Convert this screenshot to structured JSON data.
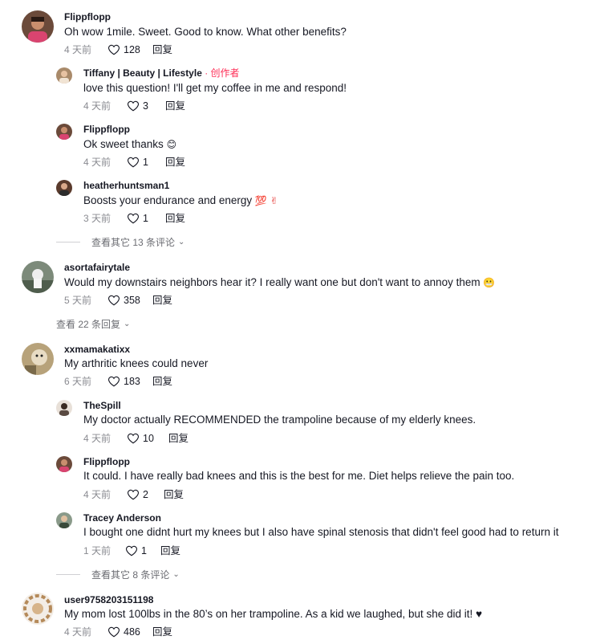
{
  "comments": [
    {
      "user": "Flippflopp",
      "text": "Oh wow 1mile. Sweet. Good to know. What other benefits?",
      "time": "4 天前",
      "likes": "128",
      "reply": "回复"
    },
    {
      "user": "Tiffany | Beauty | Lifestyle",
      "creator": " · 创作者",
      "text": "love this question! I'll get my coffee in me and respond!",
      "time": "4 天前",
      "likes": "3",
      "reply": "回复"
    },
    {
      "user": "Flippflopp",
      "text": "Ok sweet thanks",
      "emoji": "😊",
      "time": "4 天前",
      "likes": "1",
      "reply": "回复"
    },
    {
      "user": "heatherhuntsman1",
      "text": "Boosts your endurance and energy",
      "emoji": "💯 ✌",
      "time": "3 天前",
      "likes": "1",
      "reply": "回复"
    },
    {
      "user": "asortafairytale",
      "text": "Would my downstairs neighbors hear it? I really want one but don't want to annoy them",
      "emoji": "😬",
      "time": "5 天前",
      "likes": "358",
      "reply": "回复"
    },
    {
      "user": "xxmamakatixx",
      "text": "My arthritic knees could never",
      "time": "6 天前",
      "likes": "183",
      "reply": "回复"
    },
    {
      "user": "TheSpill",
      "text": "My doctor actually RECOMMENDED the trampoline because of my elderly knees.",
      "time": "4 天前",
      "likes": "10",
      "reply": "回复"
    },
    {
      "user": "Flippflopp",
      "text": "It could. I have really bad knees and this is the best for me. Diet helps relieve the pain too.",
      "time": "4 天前",
      "likes": "2",
      "reply": "回复"
    },
    {
      "user": "Tracey Anderson",
      "text": "I bought one didnt hurt my knees but I also have spinal stenosis that didn't feel good had to return it",
      "time": "1 天前",
      "likes": "1",
      "reply": "回复"
    },
    {
      "user": "user9758203151198",
      "text": "My mom lost 100lbs in the 80’s on her trampoline. As a kid we laughed, but she did it! ♥",
      "time": "4 天前",
      "likes": "486",
      "reply": "回复"
    }
  ],
  "view_more": {
    "replies_1": "查看其它 13 条评论",
    "replies_2": "查看 22 条回复",
    "replies_3": "查看其它 8 条评论"
  },
  "icons": {
    "like": "heart-outline-icon",
    "expand": "chevron-down-icon"
  },
  "colors": {
    "creator": "#fe2c55",
    "meta": "#8a8b91",
    "text": "#161823"
  }
}
